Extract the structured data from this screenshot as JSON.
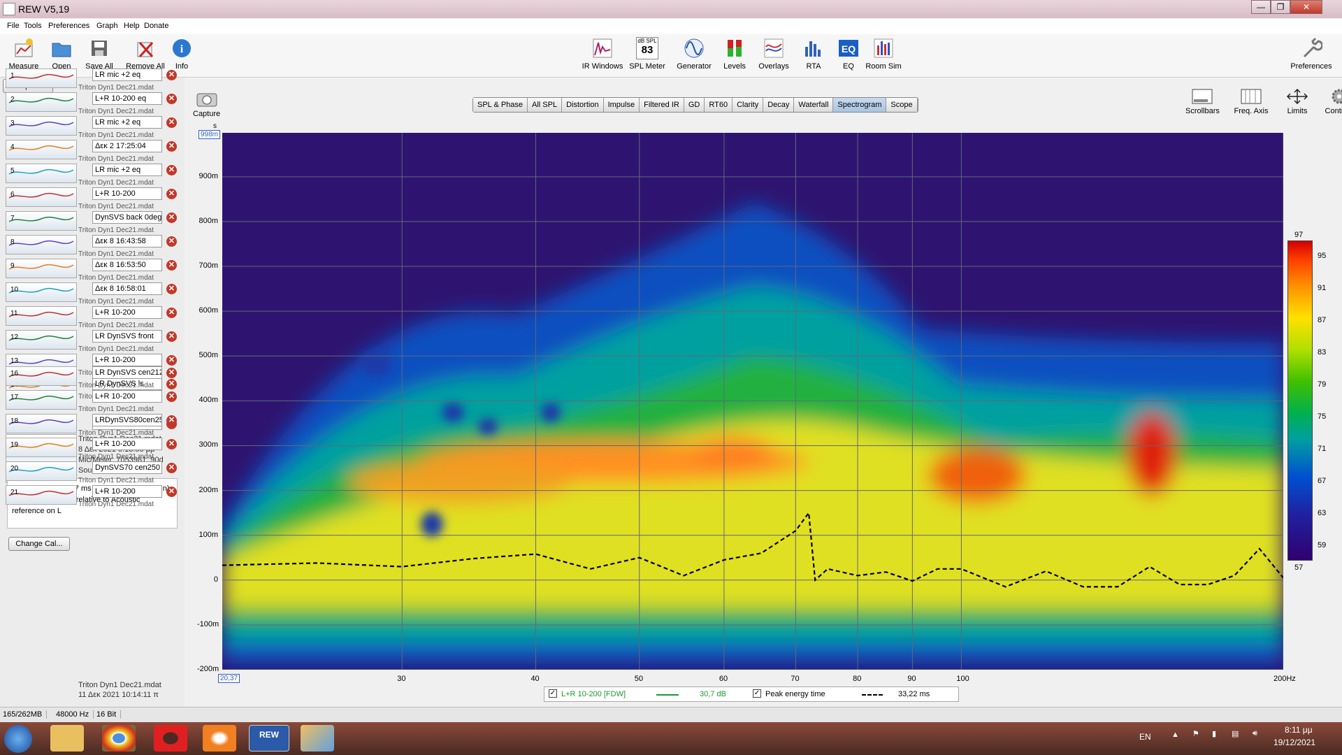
{
  "app": {
    "title": "REW V5,19",
    "minimize": "—",
    "maximize": "❐",
    "close": "✕"
  },
  "menu": [
    "File",
    "Tools",
    "Preferences",
    "Graph",
    "Help",
    "Donate"
  ],
  "toolbar": {
    "left": [
      {
        "label": "Measure",
        "icon": "measure-icon"
      },
      {
        "label": "Open",
        "icon": "folder-icon"
      },
      {
        "label": "Save All",
        "icon": "save-icon"
      },
      {
        "label": "Remove All",
        "icon": "remove-icon"
      },
      {
        "label": "Info",
        "icon": "info-icon"
      }
    ],
    "center": [
      {
        "label": "IR Windows",
        "icon": "ir-windows-icon"
      },
      {
        "label": "SPL Meter",
        "icon": "spl-meter-icon",
        "badge": "83",
        "badge_unit": "dB SPL"
      },
      {
        "label": "Generator",
        "icon": "generator-icon"
      },
      {
        "label": "Levels",
        "icon": "levels-icon"
      },
      {
        "label": "Overlays",
        "icon": "overlays-icon"
      },
      {
        "label": "RTA",
        "icon": "rta-icon"
      },
      {
        "label": "EQ",
        "icon": "eq-icon"
      },
      {
        "label": "Room Sim",
        "icon": "room-sim-icon"
      }
    ],
    "right": {
      "label": "Preferences",
      "icon": "wrench-icon"
    }
  },
  "left_panel": {
    "collapse_label": "Collapse",
    "file_text": "Triton Dyn1 Dec21.mdat",
    "measurements": [
      {
        "num": "1",
        "name": "LR mic +2 eq"
      },
      {
        "num": "2",
        "name": "L+R 10-200 eq"
      },
      {
        "num": "3",
        "name": "LR mic +2 eq"
      },
      {
        "num": "4",
        "name": "Δεκ 2 17:25:04"
      },
      {
        "num": "5",
        "name": "LR mic +2 eq"
      },
      {
        "num": "6",
        "name": "L+R 10-200"
      },
      {
        "num": "7",
        "name": "DynSVS back 0deg"
      },
      {
        "num": "8",
        "name": "Δεκ 8 16:43:58"
      },
      {
        "num": "9",
        "name": "Δεκ 8 16:53:50"
      },
      {
        "num": "10",
        "name": "Δεκ 8 16:58:01"
      },
      {
        "num": "11",
        "name": "L+R  10-200"
      },
      {
        "num": "12",
        "name": "LR DynSVS front"
      },
      {
        "num": "13",
        "name": "L+R 10-200"
      },
      {
        "num": "14",
        "name": "LR DynSVS ls"
      }
    ],
    "selected": {
      "num": "15",
      "name": "L+R 10-200",
      "file": "Triton Dyn1 Dec21.mdat",
      "date": "8 Δεκ 2021 5:18:55 μμ",
      "mic": "Mic/Meter: 7053981_90d",
      "soundcard": "Soundcard: No Cal",
      "thumb_min": "20",
      "thumb_max": "200",
      "delay_note": "Delay -3,625±0,167 ms (-1.243 mm, -48,95 in) using IR start time relative to Acoustic reference on  L",
      "change_cal": "Change Cal..."
    },
    "measurements_after": [
      {
        "num": "16",
        "name": "LR DynSVS cen212"
      },
      {
        "num": "17",
        "name": "L+R 10-200"
      },
      {
        "num": "18",
        "name": "LRDynSVS80cen250"
      },
      {
        "num": "19",
        "name": "L+R 10-200"
      },
      {
        "num": "20",
        "name": "DynSVS70 cen250"
      },
      {
        "num": "21",
        "name": "L+R 10-200"
      }
    ],
    "last": {
      "file": "Triton Dyn1 Dec21.mdat",
      "date": "11 Δεκ 2021 10:14:11 π"
    }
  },
  "graph": {
    "capture_label": "Capture",
    "tabs": [
      "SPL & Phase",
      "All SPL",
      "Distortion",
      "Impulse",
      "Filtered IR",
      "GD",
      "RT60",
      "Clarity",
      "Decay",
      "Waterfall",
      "Spectrogram",
      "Scope"
    ],
    "active_tab": "Spectrogram",
    "controls": [
      {
        "label": "Scrollbars",
        "icon": "scrollbars-icon"
      },
      {
        "label": "Freq. Axis",
        "icon": "freq-axis-icon"
      },
      {
        "label": "Limits",
        "icon": "limits-icon"
      },
      {
        "label": "Controls",
        "icon": "gear-icon"
      }
    ],
    "y_unit": "s",
    "y_top_value": "998m",
    "x_start_value": "20,37"
  },
  "chart_data": {
    "type": "heatmap",
    "title": "",
    "xlabel": "",
    "ylabel": "s",
    "x_scale": "log",
    "xlim": [
      20.37,
      200
    ],
    "ylim": [
      -200,
      998
    ],
    "y_ticks": [
      "900m",
      "800m",
      "700m",
      "600m",
      "500m",
      "400m",
      "300m",
      "200m",
      "100m",
      "0",
      "-100m",
      "-200m"
    ],
    "x_ticks": [
      "30",
      "40",
      "50",
      "60",
      "70",
      "80",
      "90",
      "100",
      "200Hz"
    ],
    "colorbar": {
      "max": "97",
      "min": "57",
      "ticks": [
        "95",
        "91",
        "87",
        "83",
        "79",
        "75",
        "71",
        "67",
        "63",
        "59"
      ]
    },
    "grid": true,
    "series": [
      {
        "name": "Peak energy time",
        "x": [
          20.37,
          25,
          30,
          35,
          40,
          45,
          50,
          55,
          60,
          65,
          70,
          72,
          73,
          75,
          80,
          85,
          90,
          95,
          100,
          110,
          120,
          130,
          140,
          150,
          160,
          170,
          180,
          190,
          200
        ],
        "y": [
          33,
          38,
          30,
          48,
          58,
          25,
          50,
          10,
          45,
          60,
          110,
          150,
          0,
          25,
          10,
          18,
          -2,
          25,
          25,
          -15,
          20,
          -15,
          -15,
          30,
          -10,
          -10,
          10,
          70,
          5
        ]
      }
    ],
    "legend": {
      "trace": "L+R 10-200 [FDW]",
      "trace_level": "30,7 dB",
      "peak_label": "Peak energy time",
      "peak_value": "33,22 ms"
    }
  },
  "status": {
    "memory": "165/262MB",
    "rate": "48000 Hz",
    "bits": "16 Bit"
  },
  "taskbar": {
    "lang": "EN",
    "time": "8:11 μμ",
    "date": "19/12/2021"
  }
}
